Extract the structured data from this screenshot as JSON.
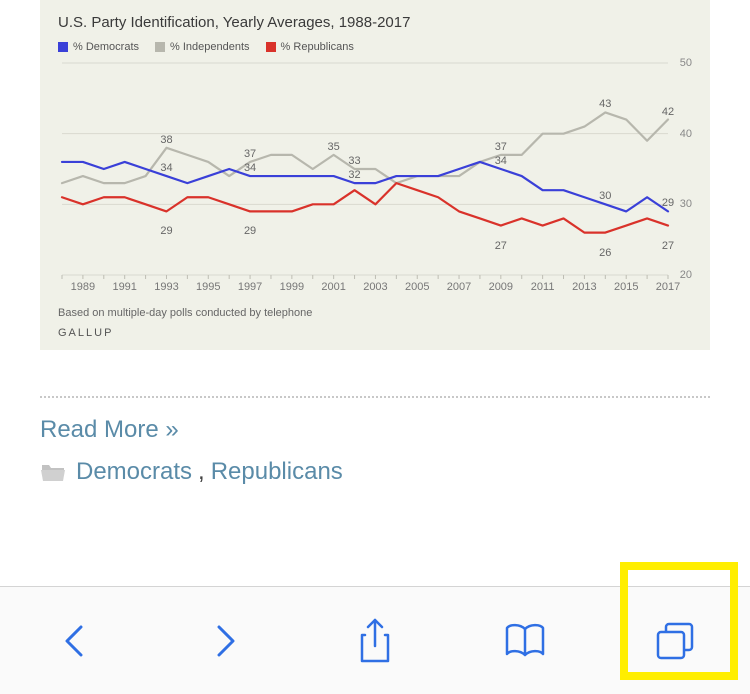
{
  "chart_data": {
    "type": "line",
    "title": "U.S. Party Identification, Yearly Averages, 1988-2017",
    "xlabel": "",
    "ylabel": "",
    "ylim": [
      20,
      50
    ],
    "xlim": [
      1988,
      2017
    ],
    "legend": [
      "% Democrats",
      "% Independents",
      "% Republicans"
    ],
    "colors": {
      "democrats": "#3a40d8",
      "independents": "#b7b7ad",
      "republicans": "#d9322a"
    },
    "x_ticks": [
      1989,
      1991,
      1993,
      1995,
      1997,
      1999,
      2001,
      2003,
      2005,
      2007,
      2009,
      2011,
      2013,
      2015,
      2017
    ],
    "y_ticks": [
      20,
      30,
      40,
      50
    ],
    "x": [
      1988,
      1989,
      1990,
      1991,
      1992,
      1993,
      1994,
      1995,
      1996,
      1997,
      1998,
      1999,
      2000,
      2001,
      2002,
      2003,
      2004,
      2005,
      2006,
      2007,
      2008,
      2009,
      2010,
      2011,
      2012,
      2013,
      2014,
      2015,
      2016,
      2017
    ],
    "series": [
      {
        "name": "% Independents",
        "values": [
          33,
          34,
          33,
          33,
          34,
          38,
          37,
          36,
          34,
          36,
          37,
          37,
          35,
          37,
          35,
          35,
          33,
          34,
          34,
          34,
          36,
          37,
          37,
          40,
          40,
          41,
          43,
          42,
          39,
          42
        ]
      },
      {
        "name": "% Democrats",
        "values": [
          36,
          36,
          35,
          36,
          35,
          34,
          33,
          34,
          35,
          34,
          34,
          34,
          34,
          34,
          33,
          33,
          34,
          34,
          34,
          35,
          36,
          35,
          34,
          32,
          32,
          31,
          30,
          29,
          31,
          29
        ]
      },
      {
        "name": "% Republicans",
        "values": [
          31,
          30,
          31,
          31,
          30,
          29,
          31,
          31,
          30,
          29,
          29,
          29,
          30,
          30,
          32,
          30,
          33,
          32,
          31,
          29,
          28,
          27,
          28,
          27,
          28,
          26,
          26,
          27,
          28,
          27
        ]
      }
    ],
    "data_labels_independents": {
      "1993": 38,
      "1997": 37,
      "2001": 35,
      "2002": 33,
      "2009": 37,
      "2014": 43,
      "2017": 42
    },
    "data_labels_democrats": {
      "1993": 34,
      "1997": 34,
      "2002": 32,
      "2009": 34,
      "2014": 30,
      "2017": 29
    },
    "data_labels_republicans": {
      "1993": 29,
      "1997": 29,
      "2009": 27,
      "2014": 26,
      "2017": 27
    },
    "footnote": "Based on multiple-day polls conducted by telephone",
    "brand": "GALLUP"
  },
  "article": {
    "read_more": "Read More »",
    "categories": [
      "Democrats",
      "Republicans"
    ],
    "category_separator": ", "
  },
  "toolbar": {
    "back": "Back",
    "forward": "Forward",
    "share": "Share",
    "bookmarks": "Bookmarks",
    "tabs": "Tabs"
  },
  "highlight": {
    "target": "tabs-button"
  }
}
